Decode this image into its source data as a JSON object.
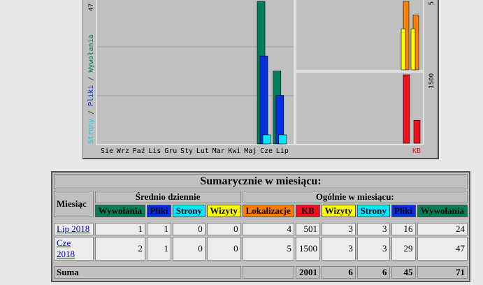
{
  "chart": {
    "colors": {
      "wywolania": "#00805a",
      "pliki": "#0030e0",
      "strony": "#00e8ff",
      "kb": "#f01020",
      "lokalizacje": "#ff8000",
      "wizyty": "#ffff00"
    },
    "y_axis_label_left": {
      "strony": "Strony",
      "sep1": " / ",
      "pliki": "Pliki",
      "sep2": " / ",
      "wywolania": "Wywołania"
    },
    "y_axis_max_left": "47",
    "y_axis_max_right_top": "5",
    "y_axis_max_right_bottom": "1500",
    "kb_label": "KB",
    "months": [
      "Sie",
      "Wrz",
      "Paź",
      "Lis",
      "Gru",
      "Sty",
      "Lut",
      "Mar",
      "Kwi",
      "Maj",
      "Cze",
      "Lip"
    ]
  },
  "chart_data": {
    "type": "bar",
    "categories": [
      "Sie",
      "Wrz",
      "Paź",
      "Lis",
      "Gru",
      "Sty",
      "Lut",
      "Mar",
      "Kwi",
      "Maj",
      "Cze",
      "Lip"
    ],
    "series": [
      {
        "name": "Wywołania",
        "values": [
          0,
          0,
          0,
          0,
          0,
          0,
          0,
          0,
          0,
          0,
          47,
          24
        ]
      },
      {
        "name": "Pliki",
        "values": [
          0,
          0,
          0,
          0,
          0,
          0,
          0,
          0,
          0,
          0,
          29,
          16
        ]
      },
      {
        "name": "Strony",
        "values": [
          0,
          0,
          0,
          0,
          0,
          0,
          0,
          0,
          0,
          0,
          3,
          3
        ]
      }
    ],
    "ylim": [
      0,
      47
    ],
    "right_panels": {
      "top": {
        "series": [
          {
            "name": "Lokalizacje",
            "values": [
              5,
              4
            ]
          },
          {
            "name": "Wizyty",
            "values": [
              3,
              3
            ]
          }
        ],
        "ylim": [
          0,
          5
        ]
      },
      "bottom": {
        "series": [
          {
            "name": "KB",
            "values": [
              1500,
              501
            ]
          }
        ],
        "ylim": [
          0,
          1500
        ]
      }
    }
  },
  "summary": {
    "title": "Sumarycznie w miesiącu:",
    "col_month": "Miesiąc",
    "daily_header": "Średnio dziennie",
    "monthly_header": "Ogólnie w miesiącu:",
    "daily_cols": [
      "Wywołania",
      "Pliki",
      "Strony",
      "Wizyty"
    ],
    "monthly_cols": [
      "Lokalizacje",
      "KB",
      "Wizyty",
      "Strony",
      "Pliki",
      "Wywołania"
    ],
    "rows": [
      {
        "month": "Lip 2018",
        "daily": [
          "1",
          "1",
          "0",
          "0"
        ],
        "monthly": [
          "4",
          "501",
          "3",
          "3",
          "16",
          "24"
        ]
      },
      {
        "month": "Cze 2018",
        "daily": [
          "2",
          "1",
          "0",
          "0"
        ],
        "monthly": [
          "5",
          "1500",
          "3",
          "3",
          "29",
          "47"
        ]
      }
    ],
    "total": {
      "label": "Suma",
      "values": [
        "2001",
        "6",
        "6",
        "45",
        "71"
      ]
    }
  }
}
